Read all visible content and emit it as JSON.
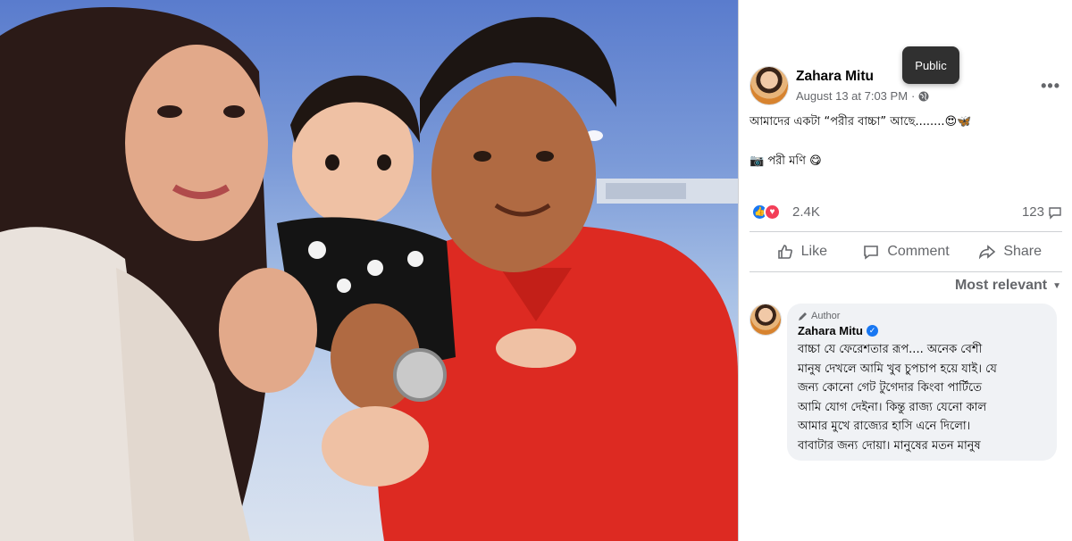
{
  "photo": {
    "description_icon": "photo-image"
  },
  "tooltip": {
    "text": "Public"
  },
  "post": {
    "author": "Zahara Mitu",
    "timestamp": "August 13 at 7:03 PM",
    "separator": "·",
    "privacy_icon": "globe-icon",
    "more_icon": "more-horizontal-icon",
    "text_line1": "আমাদের একটা “পরীর বাচ্চা” আছে........😍🦋",
    "text_line2": "📷 পরী মণি 😋"
  },
  "reactions": {
    "count": "2.4K",
    "comments": "123",
    "icons": [
      "like-reaction-icon",
      "love-reaction-icon"
    ]
  },
  "actions": {
    "like": "Like",
    "comment": "Comment",
    "share": "Share"
  },
  "sort": {
    "label": "Most relevant"
  },
  "comment": {
    "badge": "Author",
    "name": "Zahara Mitu",
    "lines": [
      "বাচ্চা যে ফেরেশতার রূপ.... অনেক বেশী",
      "মানুষ দেখলে আমি খুব চুপচাপ হয়ে যাই। যে",
      "জন্য কোনো গেট টুগেদার কিংবা পার্টিতে",
      "আমি যোগ দেইনা। কিন্তু রাজ্য যেনো কাল",
      "আমার মুখে রাজ্যের হাসি এনে দিলো।",
      "বাবাটার জন্য দোয়া। মানুষের মতন মানুষ"
    ]
  },
  "colors": {
    "accent": "#1877f2",
    "love": "#f33e58",
    "secondary_text": "#65676b",
    "bubble": "#f0f2f5"
  }
}
